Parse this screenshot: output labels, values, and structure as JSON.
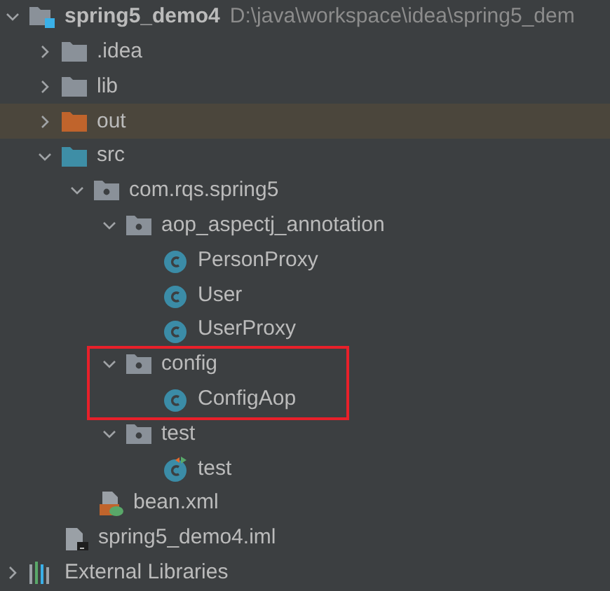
{
  "tree": [
    {
      "label": "spring5_demo4",
      "path": "D:\\java\\workspace\\idea\\spring5_dem",
      "kind": "project",
      "expanded": true,
      "selected": false,
      "children": [
        {
          "label": ".idea",
          "kind": "folder",
          "expanded": false,
          "selected": false
        },
        {
          "label": "lib",
          "kind": "folder",
          "expanded": false,
          "selected": false
        },
        {
          "label": "out",
          "kind": "excluded",
          "expanded": false,
          "selected": true
        },
        {
          "label": "src",
          "kind": "source",
          "expanded": true,
          "selected": false,
          "children": [
            {
              "label": "com.rqs.spring5",
              "kind": "package",
              "expanded": true,
              "selected": false,
              "children": [
                {
                  "label": "aop_aspectj_annotation",
                  "kind": "package",
                  "expanded": true,
                  "selected": false,
                  "children": [
                    {
                      "label": "PersonProxy",
                      "kind": "class",
                      "selected": false
                    },
                    {
                      "label": "User",
                      "kind": "class",
                      "selected": false
                    },
                    {
                      "label": "UserProxy",
                      "kind": "class",
                      "selected": false
                    }
                  ]
                },
                {
                  "label": "config",
                  "kind": "package",
                  "expanded": true,
                  "selected": false,
                  "annotated": true,
                  "children": [
                    {
                      "label": "ConfigAop",
                      "kind": "class",
                      "selected": false
                    }
                  ]
                },
                {
                  "label": "test",
                  "kind": "package",
                  "expanded": true,
                  "selected": false,
                  "children": [
                    {
                      "label": "test",
                      "kind": "runnable",
                      "selected": false
                    }
                  ]
                }
              ]
            },
            {
              "label": "bean.xml",
              "kind": "xml",
              "selected": false
            }
          ]
        },
        {
          "label": "spring5_demo4.iml",
          "kind": "iml",
          "selected": false
        }
      ]
    },
    {
      "label": "External Libraries",
      "kind": "libraries",
      "expanded": false,
      "selected": false
    }
  ]
}
